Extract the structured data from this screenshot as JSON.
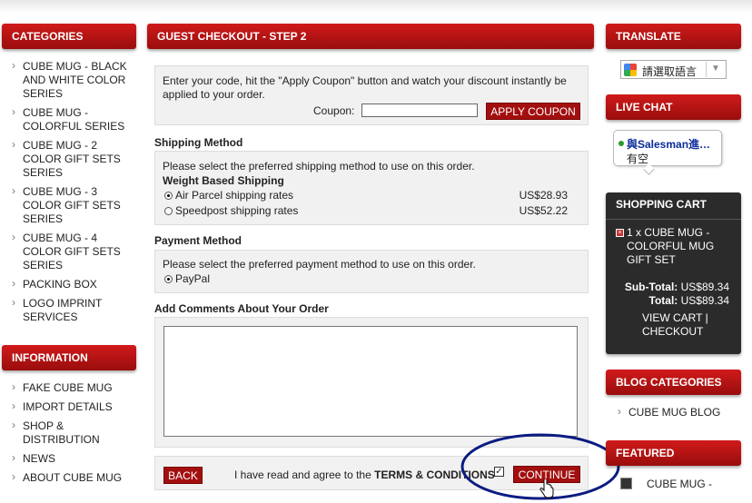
{
  "left": {
    "categories_title": "CATEGORIES",
    "categories": [
      "CUBE MUG - BLACK AND WHITE COLOR SERIES",
      "CUBE MUG - COLORFUL SERIES",
      "CUBE MUG - 2 COLOR GIFT SETS SERIES",
      "CUBE MUG - 3 COLOR GIFT SETS SERIES",
      "CUBE MUG - 4 COLOR GIFT SETS SERIES",
      "PACKING BOX",
      "LOGO IMPRINT SERVICES"
    ],
    "information_title": "INFORMATION",
    "information": [
      "FAKE CUBE MUG",
      "IMPORT DETAILS",
      "SHOP & DISTRIBUTION",
      "NEWS",
      "ABOUT CUBE MUG"
    ]
  },
  "main": {
    "title": "GUEST CHECKOUT - STEP 2",
    "coupon_intro": "Enter your code, hit the \"Apply Coupon\" button and watch your discount instantly be applied to your order.",
    "coupon_label": "Coupon:",
    "coupon_value": "",
    "apply_coupon": "APPLY COUPON",
    "shipping_title": "Shipping Method",
    "shipping_intro": "Please select the preferred shipping method to use on this order.",
    "shipping_group": "Weight Based Shipping",
    "shipping_options": [
      {
        "label": "Air Parcel shipping rates",
        "price": "US$28.93",
        "selected": true
      },
      {
        "label": "Speedpost shipping rates",
        "price": "US$52.22",
        "selected": false
      }
    ],
    "payment_title": "Payment Method",
    "payment_intro": "Please select the preferred payment method to use on this order.",
    "payment_option": "PayPal",
    "comments_title": "Add Comments About Your Order",
    "comments_value": "",
    "back": "BACK",
    "agree_text": "I have read and agree to the",
    "terms": "TERMS & CONDITIONS",
    "continue": "CONTINUE"
  },
  "right": {
    "translate_title": "TRANSLATE",
    "translate_select": "請選取語言",
    "livechat_title": "LIVE CHAT",
    "livechat_name": "與Salesman進…",
    "livechat_status": "有空",
    "cart_title": "SHOPPING CART",
    "cart_item": "1 x CUBE MUG - COLORFUL MUG GIFT SET",
    "subtotal_label": "Sub-Total:",
    "subtotal_value": "US$89.34",
    "total_label": "Total:",
    "total_value": "US$89.34",
    "view_cart": "VIEW CART",
    "checkout": "CHECKOUT",
    "blog_title": "BLOG CATEGORIES",
    "blog_item": "CUBE MUG BLOG",
    "featured_title": "FEATURED",
    "featured_item": "CUBE MUG -"
  },
  "colors": {
    "brand_red": "#b01414",
    "highlight_circle": "#0b1c82",
    "cart_bg": "#2b2b2b"
  }
}
